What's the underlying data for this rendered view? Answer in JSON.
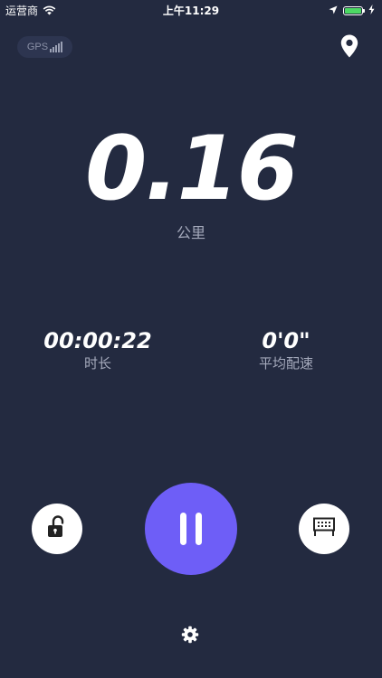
{
  "status_bar": {
    "carrier": "运营商",
    "time": "上午11:29"
  },
  "gps": {
    "label": "GPS"
  },
  "distance": {
    "value": "0.16",
    "unit": "公里"
  },
  "metrics": {
    "duration": {
      "value": "00:00:22",
      "label": "时长"
    },
    "pace": {
      "value": "0'0\"",
      "label": "平均配速"
    }
  },
  "colors": {
    "background": "#232a40",
    "accent": "#6e5ef7",
    "battery": "#4cd964",
    "muted_text": "#a4a9bb"
  },
  "icons": {
    "wifi": "wifi-icon",
    "location_arrow": "location-arrow-icon",
    "battery": "battery-icon",
    "charging": "charging-bolt-icon",
    "gps_signal": "gps-signal-icon",
    "map_pin": "map-pin-icon",
    "unlock": "unlock-icon",
    "pause": "pause-icon",
    "chart": "chart-icon",
    "settings": "gear-icon"
  }
}
